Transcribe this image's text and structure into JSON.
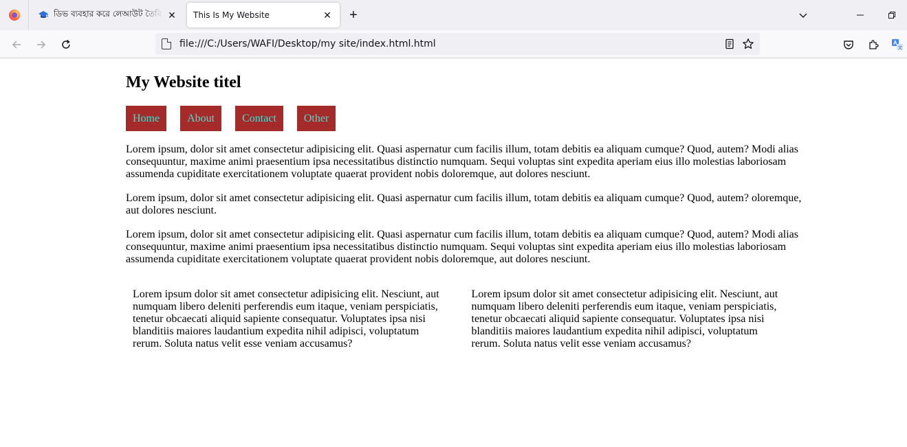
{
  "browser": {
    "tabs": [
      {
        "title": "ডিভ ব্যবহার করে লেআউট তৈরি - শ",
        "close": "✕"
      },
      {
        "title": "This Is My Website",
        "close": "✕"
      }
    ],
    "new_tab": "+",
    "url": "file:///C:/Users/WAFI/Desktop/my site/index.html.html"
  },
  "page": {
    "title": "My Website titel",
    "menu": [
      "Home",
      "About",
      "Contact",
      "Other"
    ],
    "colors": {
      "menu_bg": "#a52a2a",
      "menu_text": "#40e0d0"
    },
    "paragraphs": [
      "Lorem ipsum, dolor sit amet consectetur adipisicing elit. Quasi aspernatur cum facilis illum, totam debitis ea aliquam cumque? Quod, autem? Modi alias consequuntur, maxime animi praesentium ipsa necessitatibus distinctio numquam. Sequi voluptas sint expedita aperiam eius illo molestias laboriosam assumenda cupiditate exercitationem voluptate quaerat provident nobis doloremque, aut dolores nesciunt.",
      "Lorem ipsum, dolor sit amet consectetur adipisicing elit. Quasi aspernatur cum facilis illum, totam debitis ea aliquam cumque? Quod, autem? oloremque, aut dolores nesciunt.",
      "Lorem ipsum, dolor sit amet consectetur adipisicing elit. Quasi aspernatur cum facilis illum, totam debitis ea aliquam cumque? Quod, autem? Modi alias consequuntur, maxime animi praesentium ipsa necessitatibus distinctio numquam. Sequi voluptas sint expedita aperiam eius illo molestias laboriosam assumenda cupiditate exercitationem voluptate quaerat provident nobis doloremque, aut dolores nesciunt."
    ],
    "columns": [
      "Lorem ipsum dolor sit amet consectetur adipisicing elit. Nesciunt, aut numquam libero deleniti perferendis eum itaque, veniam perspiciatis, tenetur obcaecati aliquid sapiente consequatur. Voluptates ipsa nisi blanditiis maiores laudantium expedita nihil adipisci, voluptatum rerum. Soluta natus velit esse veniam accusamus?",
      "Lorem ipsum dolor sit amet consectetur adipisicing elit. Nesciunt, aut numquam libero deleniti perferendis eum itaque, veniam perspiciatis, tenetur obcaecati aliquid sapiente consequatur. Voluptates ipsa nisi blanditiis maiores laudantium expedita nihil adipisci, voluptatum rerum. Soluta natus velit esse veniam accusamus?"
    ]
  }
}
